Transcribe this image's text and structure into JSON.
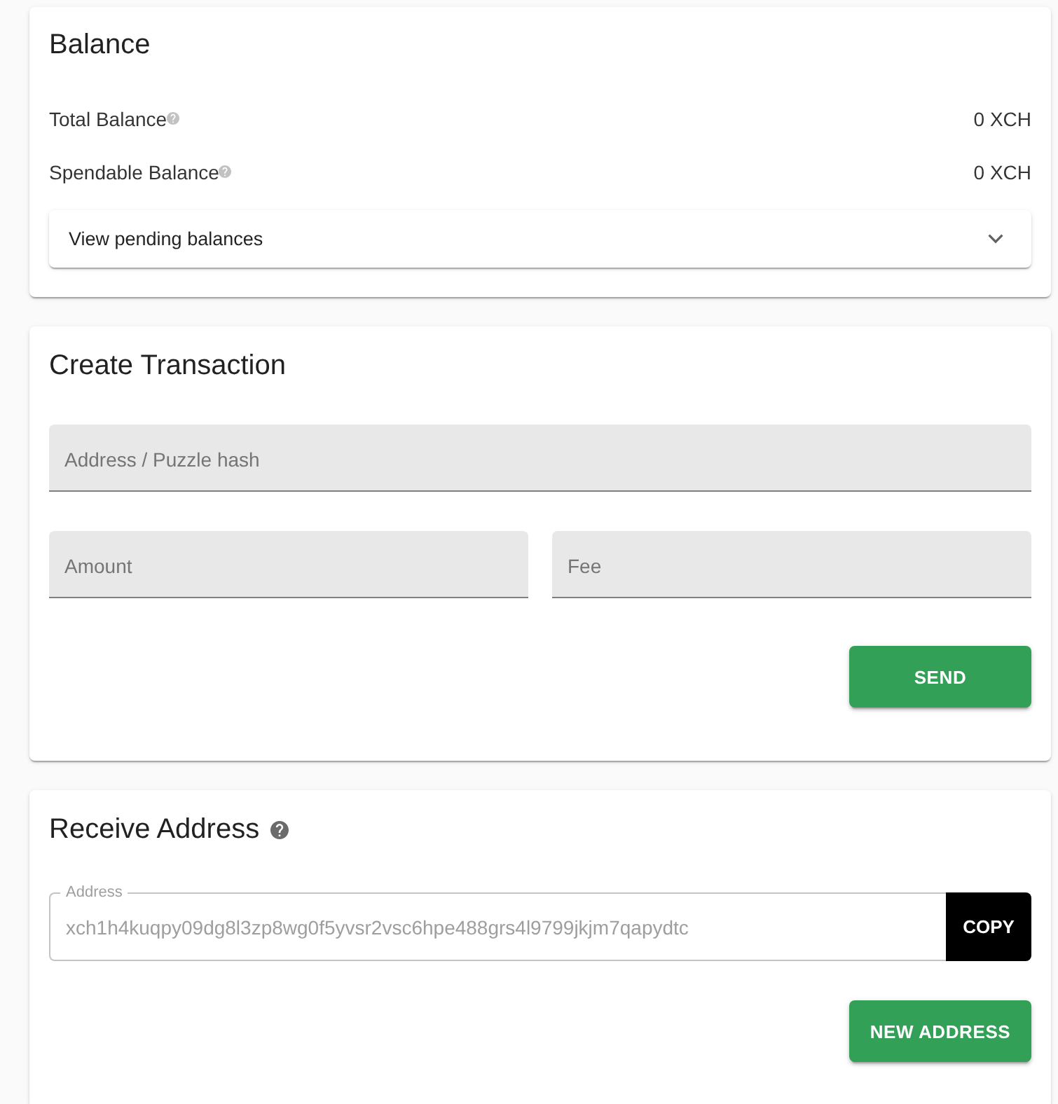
{
  "balance": {
    "title": "Balance",
    "rows": [
      {
        "label": "Total Balance",
        "value": "0 XCH"
      },
      {
        "label": "Spendable Balance",
        "value": "0 XCH"
      }
    ],
    "pending": {
      "label": "View pending balances",
      "expanded": false
    }
  },
  "create_transaction": {
    "title": "Create Transaction",
    "address_field": {
      "placeholder": "Address / Puzzle hash"
    },
    "amount_field": {
      "placeholder": "Amount"
    },
    "fee_field": {
      "placeholder": "Fee"
    },
    "send_button": "SEND"
  },
  "receive_address": {
    "title": "Receive Address",
    "address_field": {
      "label": "Address",
      "value": "xch1h4kuqpy09dg8l3zp8wg0f5yvsr2vsc6hpe488grs4l9799jkjm7qapydtc",
      "disabled": true
    },
    "copy_button": "COPY",
    "new_address_button": "NEW ADDRESS"
  }
}
